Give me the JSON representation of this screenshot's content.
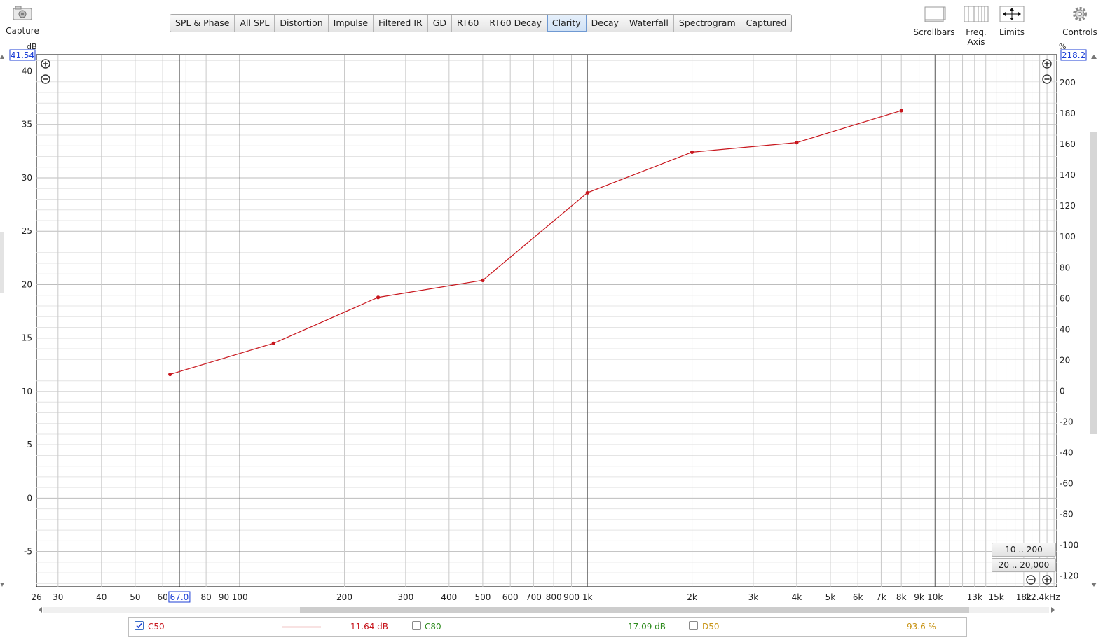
{
  "toolbar": {
    "capture_label": "Capture",
    "tabs": [
      "SPL & Phase",
      "All SPL",
      "Distortion",
      "Impulse",
      "Filtered IR",
      "GD",
      "RT60",
      "RT60 Decay",
      "Clarity",
      "Decay",
      "Waterfall",
      "Spectrogram",
      "Captured"
    ],
    "active_tab": "Clarity",
    "scrollbars_label": "Scrollbars",
    "freq_axis_label": "Freq. Axis",
    "limits_label": "Limits",
    "controls_label": "Controls"
  },
  "axes": {
    "left_unit": "dB",
    "right_unit": "%",
    "left_top_value": "41.54",
    "right_top_value": "218.2",
    "cursor_value": "67.0",
    "x_unit_suffix": "kHz"
  },
  "range_buttons": [
    "10 .. 200",
    "20 .. 20,000"
  ],
  "legend": {
    "c50_label": "C50",
    "c50_value": "11.64 dB",
    "c50_checked": true,
    "c80_label": "C80",
    "c80_value": "17.09 dB",
    "c80_checked": false,
    "d50_label": "D50",
    "d50_value": "93.6 %",
    "d50_checked": false
  },
  "colors": {
    "c50": "#c8161d",
    "c80": "#2e8b1e",
    "d50": "#c89416",
    "accent": "#1c3fd6"
  },
  "chart_data": {
    "type": "line",
    "x_scale": "log",
    "xlim": [
      26,
      22400
    ],
    "ylim": [
      -8.3,
      41.54
    ],
    "y2lim": [
      -127,
      218.2
    ],
    "x_ticks": [
      {
        "v": 26,
        "t": "26"
      },
      {
        "v": 30,
        "t": "30"
      },
      {
        "v": 40,
        "t": "40"
      },
      {
        "v": 50,
        "t": "50"
      },
      {
        "v": 60,
        "t": "60"
      },
      {
        "v": 80,
        "t": "80"
      },
      {
        "v": 90,
        "t": "90"
      },
      {
        "v": 100,
        "t": "100"
      },
      {
        "v": 200,
        "t": "200"
      },
      {
        "v": 300,
        "t": "300"
      },
      {
        "v": 400,
        "t": "400"
      },
      {
        "v": 500,
        "t": "500"
      },
      {
        "v": 600,
        "t": "600"
      },
      {
        "v": 700,
        "t": "700"
      },
      {
        "v": 800,
        "t": "800"
      },
      {
        "v": 900,
        "t": "900"
      },
      {
        "v": 1000,
        "t": "1k"
      },
      {
        "v": 2000,
        "t": "2k"
      },
      {
        "v": 3000,
        "t": "3k"
      },
      {
        "v": 4000,
        "t": "4k"
      },
      {
        "v": 5000,
        "t": "5k"
      },
      {
        "v": 6000,
        "t": "6k"
      },
      {
        "v": 7000,
        "t": "7k"
      },
      {
        "v": 8000,
        "t": "8k"
      },
      {
        "v": 9000,
        "t": "9k"
      },
      {
        "v": 10000,
        "t": "10k"
      },
      {
        "v": 13000,
        "t": "13k"
      },
      {
        "v": 15000,
        "t": "15k"
      },
      {
        "v": 18000,
        "t": "18k"
      },
      {
        "v": 22400,
        "t": "22.4kHz"
      }
    ],
    "y_ticks": [
      40,
      35,
      30,
      25,
      20,
      15,
      10,
      5,
      0,
      -5
    ],
    "y2_ticks": [
      200,
      180,
      160,
      140,
      120,
      100,
      80,
      60,
      40,
      20,
      0,
      -20,
      -40,
      -60,
      -80,
      -100,
      -120
    ],
    "cursor_x": 67,
    "series": [
      {
        "name": "C50",
        "x": [
          63,
          125,
          250,
          500,
          1000,
          2000,
          4000,
          8000
        ],
        "y": [
          11.6,
          14.5,
          18.8,
          20.4,
          28.6,
          32.4,
          33.3,
          36.3
        ]
      }
    ]
  }
}
